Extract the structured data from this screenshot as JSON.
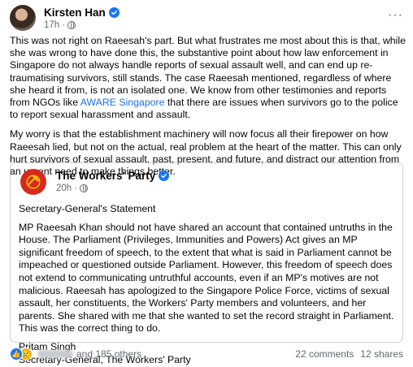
{
  "post": {
    "author": "Kirsten Han",
    "time": "17h",
    "more_label": "···",
    "paragraphs": [
      "This was not right on Raeesah's part. But what frustrates me most about this is that, while she was wrong to have done this, the substantive point about how law enforcement in Singapore do not always handle reports of sexual assault well, and can end up re-traumatising survivors, still stands. The case Raeesah mentioned, regardless of where she heard it from, is not an isolated one. We know from other testimonies and reports from NGOs like ",
      "My worry is that the establishment machinery will now focus all their firepower on how Raeesah lied, but not on the actual, real problem at the heart of the matter. This can only hurt survivors of sexual assault, past, present, and future, and distract our attention from an urgent need to make things better."
    ],
    "link_text": "AWARE Singapore",
    "paragraph1_tail": " that there are issues when survivors go to the police to report sexual harassment and assault."
  },
  "shared_post": {
    "author": "The Workers' Party",
    "time": "20h",
    "heading": "Secretary-General's Statement",
    "statement": "MP Raeesah Khan should not have shared an account that contained untruths in the House. The Parliament (Privileges, Immunities and Powers) Act gives an MP significant freedom of speech, to the extent that what is said in Parliament cannot be impeached or questioned outside Parliament. However, this freedom of speech does not extend to communicating untruthful accounts, even if an MP's motives are not malicious. Raeesah has apologized to the Singapore Police Force, victims of sexual assault, her constituents, the Workers' Party members and volunteers, and her parents. She shared with me that she wanted to set the record straight in Parliament. This was the correct thing to do.",
    "signature_name": "Pritam Singh",
    "signature_title": "Secretary-General, The Workers' Party"
  },
  "footer": {
    "reactions_text": "and 185 others",
    "comments": "22 comments",
    "shares": "12 shares"
  },
  "icons": {
    "verified": "verified-badge-icon",
    "privacy": "globe-icon",
    "reactions": [
      "like-icon",
      "sad-icon"
    ]
  },
  "colors": {
    "link": "#216fdb",
    "verified": "#1877f2",
    "party_logo": "#d62a1e",
    "secondary_text": "#65676b"
  }
}
